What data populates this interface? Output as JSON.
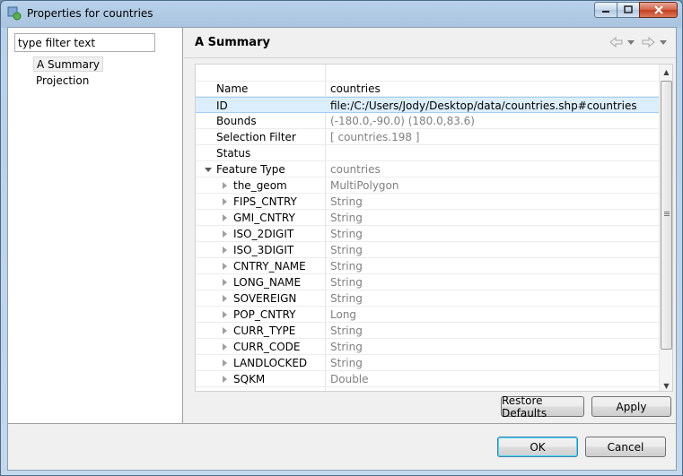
{
  "window": {
    "title": "Properties for countries"
  },
  "filter": {
    "value": "type filter text"
  },
  "nav": [
    {
      "label": "A Summary",
      "selected": true
    },
    {
      "label": "Projection",
      "selected": false
    }
  ],
  "page": {
    "title": "A Summary"
  },
  "properties": [
    {
      "name": "",
      "value": ""
    },
    {
      "name": "Name",
      "value": "countries",
      "dark": true
    },
    {
      "name": "ID",
      "value": "file:/C:/Users/Jody/Desktop/data/countries.shp#countries",
      "dark": true,
      "selected": true
    },
    {
      "name": "Bounds",
      "value": "(-180.0,-90.0) (180.0,83.6)"
    },
    {
      "name": "Selection Filter",
      "value": "[ countries.198 ]"
    },
    {
      "name": "Status",
      "value": ""
    },
    {
      "name": "Feature Type",
      "value": "countries",
      "expanded": true
    },
    {
      "name": "the_geom",
      "value": "MultiPolygon",
      "child": true
    },
    {
      "name": "FIPS_CNTRY",
      "value": "String",
      "child": true
    },
    {
      "name": "GMI_CNTRY",
      "value": "String",
      "child": true
    },
    {
      "name": "ISO_2DIGIT",
      "value": "String",
      "child": true
    },
    {
      "name": "ISO_3DIGIT",
      "value": "String",
      "child": true
    },
    {
      "name": "CNTRY_NAME",
      "value": "String",
      "child": true
    },
    {
      "name": "LONG_NAME",
      "value": "String",
      "child": true
    },
    {
      "name": "SOVEREIGN",
      "value": "String",
      "child": true
    },
    {
      "name": "POP_CNTRY",
      "value": "Long",
      "child": true
    },
    {
      "name": "CURR_TYPE",
      "value": "String",
      "child": true
    },
    {
      "name": "CURR_CODE",
      "value": "String",
      "child": true
    },
    {
      "name": "LANDLOCKED",
      "value": "String",
      "child": true
    },
    {
      "name": "SQKM",
      "value": "Double",
      "child": true
    }
  ],
  "buttons": {
    "restore_defaults": "Restore Defaults",
    "apply": "Apply",
    "ok": "OK",
    "cancel": "Cancel"
  },
  "icons": {
    "back": "back-arrow-icon",
    "forward": "forward-arrow-icon",
    "menu": "chevron-down-icon"
  }
}
